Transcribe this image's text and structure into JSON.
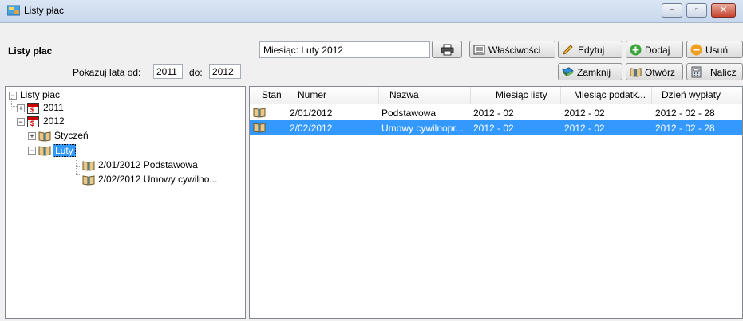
{
  "window": {
    "title": "Listy płac",
    "icon": "payroll-window-icon"
  },
  "left": {
    "panel_title": "Listy płac",
    "years_label_from": "Pokazuj lata od:",
    "year_from": "2011",
    "years_label_to": "do:",
    "year_to": "2012",
    "tree": {
      "root": "Listy płac",
      "year_2011": "2011",
      "year_2012": "2012",
      "month_jan": "Styczeń",
      "month_feb": "Luty",
      "list_1": "2/01/2012  Podstawowa",
      "list_2": "2/02/2012  Umowy cywilno..."
    }
  },
  "toolbar": {
    "month_value": "Miesiąc: Luty 2012",
    "print_icon": "printer-icon",
    "properties": "Właściwości",
    "edit": "Edytuj",
    "add": "Dodaj",
    "delete": "Usuń",
    "close_list": "Zamknij",
    "open_list": "Otwórz",
    "calculate": "Nalicz"
  },
  "grid": {
    "columns": [
      "Stan",
      "Numer",
      "Nazwa",
      "Miesiąc listy",
      "Miesiąc podatk...",
      "Dzień wypłaty"
    ],
    "rows": [
      {
        "status_icon": "open-book-icon",
        "numer": "2/01/2012",
        "nazwa": "Podstawowa",
        "miesiac_listy": "2012 - 02",
        "miesiac_podatk": "2012 - 02",
        "dzien_wyplaty": "2012 - 02 - 28"
      },
      {
        "status_icon": "open-book-icon",
        "numer": "2/02/2012",
        "nazwa": "Umowy cywilnopr...",
        "miesiac_listy": "2012 - 02",
        "miesiac_podatk": "2012 - 02",
        "dzien_wyplaty": "2012 - 02 - 28"
      }
    ],
    "selected_row": 1
  },
  "colors": {
    "selection": "#3399ff"
  }
}
